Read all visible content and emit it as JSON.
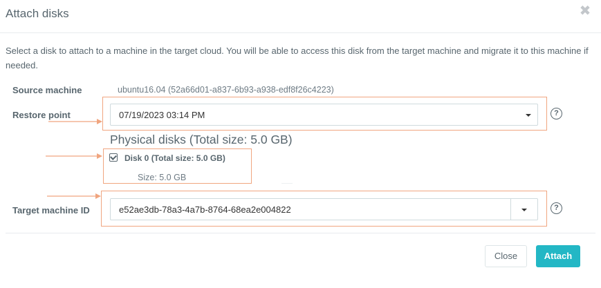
{
  "modal": {
    "title": "Attach disks",
    "intro": "Select a disk to attach to a machine in the target cloud. You will be able to access this disk from the target machine and migrate it to this machine if needed."
  },
  "source_machine": {
    "label": "Source machine",
    "value": "ubuntu16.04 (52a66d01-a837-6b93-a938-edf8f26c4223)"
  },
  "restore_point": {
    "label": "Restore point",
    "selected": "07/19/2023 03:14 PM"
  },
  "physical_disks": {
    "title": "Physical disks (Total size: 5.0 GB)",
    "disks": [
      {
        "label": "Disk 0 (Total size: 5.0 GB)",
        "size": "Size: 5.0 GB",
        "checked": true
      }
    ]
  },
  "target_machine": {
    "label": "Target machine ID",
    "selected": "e52ae3db-78a3-4a7b-8764-68ea2e004822"
  },
  "buttons": {
    "close": "Close",
    "attach": "Attach"
  },
  "help_glyph": "?",
  "colors": {
    "accent": "#23b7c5",
    "annotation": "#f0a57f",
    "text": "#58666e"
  }
}
